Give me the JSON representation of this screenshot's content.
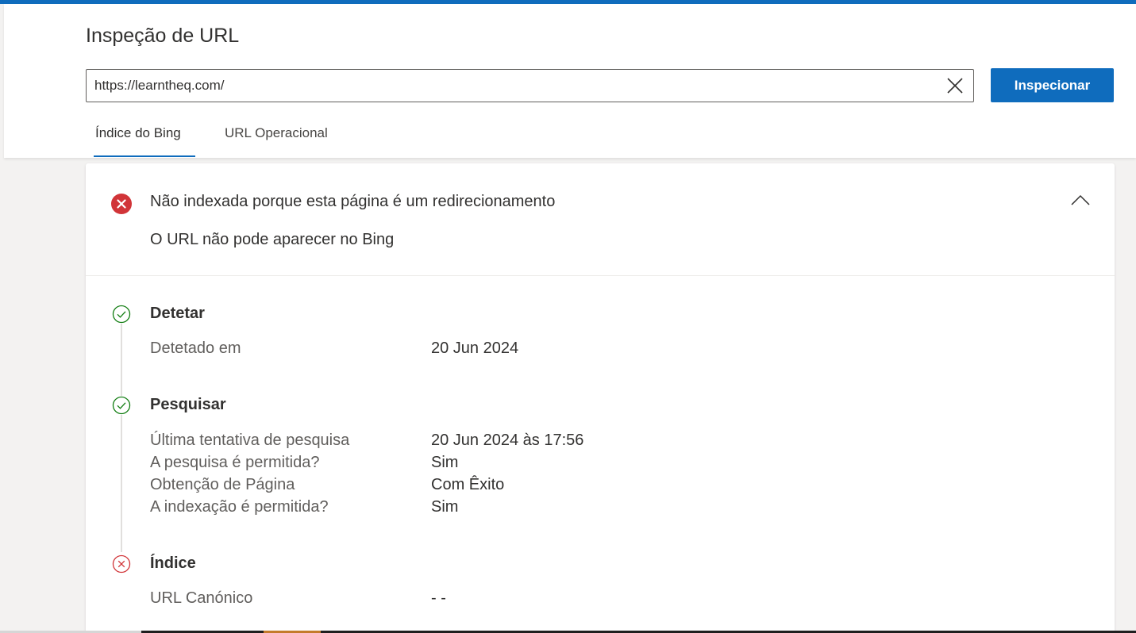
{
  "page": {
    "title": "Inspeção de URL"
  },
  "search": {
    "url_value": "https://learntheq.com/",
    "clear_icon": "close-icon",
    "inspect_label": "Inspecionar"
  },
  "tabs": [
    {
      "label": "Índice do Bing",
      "selected": true
    },
    {
      "label": "URL Operacional",
      "selected": false
    }
  ],
  "status": {
    "icon": "error-icon",
    "title": "Não indexada porque esta página é um redirecionamento",
    "subtitle": "O URL não pode aparecer no Bing",
    "expanded": true
  },
  "steps": [
    {
      "title": "Detetar",
      "state": "success",
      "rows": [
        {
          "label": "Detetado em",
          "value": "20 Jun 2024"
        }
      ]
    },
    {
      "title": "Pesquisar",
      "state": "success",
      "rows": [
        {
          "label": "Última tentativa de pesquisa",
          "value": "20 Jun 2024 às 17:56"
        },
        {
          "label": "A pesquisa é permitida?",
          "value": "Sim"
        },
        {
          "label": "Obtenção de Página",
          "value": "Com Êxito"
        },
        {
          "label": "A indexação é permitida?",
          "value": "Sim"
        }
      ]
    },
    {
      "title": "Índice",
      "state": "error",
      "rows": [
        {
          "label": "URL Canónico",
          "value": "- -"
        }
      ]
    }
  ],
  "colors": {
    "accent": "#0f6cbd",
    "success": "#107c10",
    "error": "#d13438"
  }
}
